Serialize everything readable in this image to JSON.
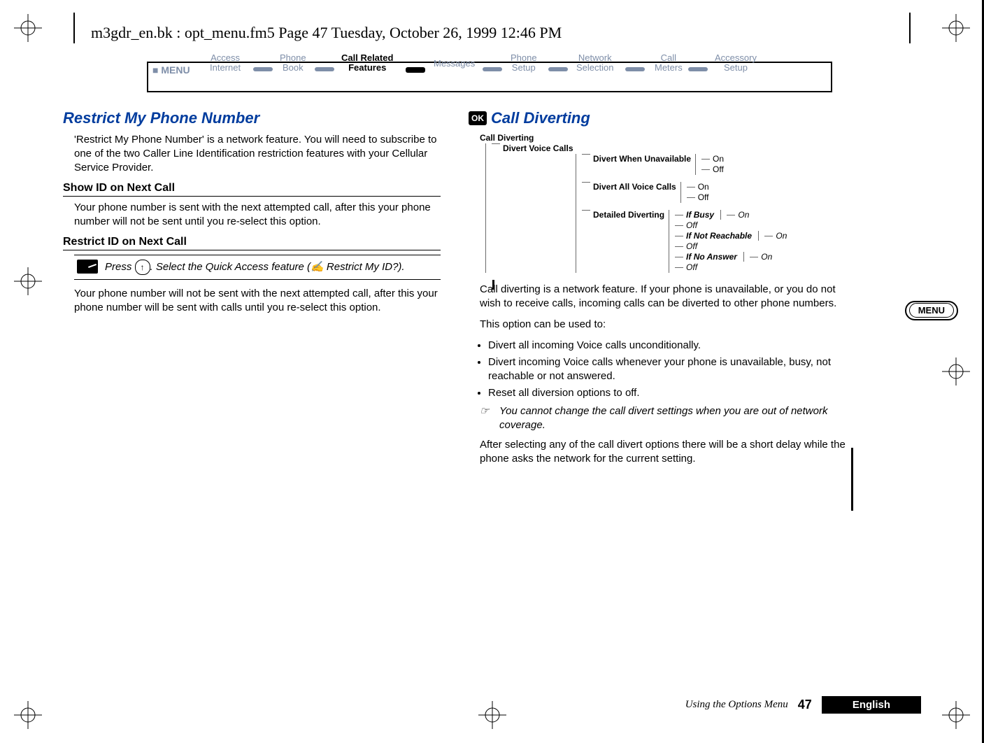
{
  "header_line": "m3gdr_en.bk : opt_menu.fm5  Page 47  Tuesday, October 26, 1999  12:46 PM",
  "menu": {
    "leading": "MENU",
    "items": [
      {
        "top": "Access",
        "bottom": "Internet",
        "active": false
      },
      {
        "top": "Phone",
        "bottom": "Book",
        "active": false
      },
      {
        "top": "Call Related",
        "bottom": "Features",
        "active": true
      },
      {
        "top": "Messages",
        "bottom": "",
        "active": false
      },
      {
        "top": "Phone",
        "bottom": "Setup",
        "active": false
      },
      {
        "top": "Network",
        "bottom": "Selection",
        "active": false
      },
      {
        "top": "Call",
        "bottom": "Meters",
        "active": false
      },
      {
        "top": "Accessory",
        "bottom": "Setup",
        "active": false
      }
    ]
  },
  "left": {
    "title": "Restrict My Phone Number",
    "intro": "'Restrict My Phone Number' is a network feature. You will need to subscribe to one of the two Caller Line Identification restriction features with your Cellular Service Provider.",
    "sub1": "Show ID on Next Call",
    "sub1_body": "Your phone number is sent with the next attempted call, after this your phone number will not be sent until you re-select this option.",
    "sub2": "Restrict ID on Next Call",
    "quick_prefix": "Press ",
    "quick_key": "↑",
    "quick_middle": ". Select the Quick Access feature (",
    "quick_icon": "✍",
    "quick_suffix": " Restrict My ID?).",
    "sub2_body": "Your phone number will not be sent with the next attempted call, after this your phone number will be sent with calls until you re-select this option."
  },
  "right": {
    "ok_label": "OK",
    "title": "Call Diverting",
    "tree": {
      "root": "Call Diverting",
      "l1": "Divert Voice Calls",
      "n1": {
        "label": "Divert When Unavailable",
        "opts": [
          "On",
          "Off"
        ]
      },
      "n2": {
        "label": "Divert All Voice Calls",
        "opts": [
          "On",
          "Off"
        ]
      },
      "n3": {
        "label": "Detailed Diverting",
        "children": [
          {
            "label": "If Busy",
            "opts": [
              "On",
              "Off"
            ]
          },
          {
            "label": "If Not Reachable",
            "opts": [
              "On",
              "Off"
            ]
          },
          {
            "label": "If No Answer",
            "opts": [
              "On",
              "Off"
            ]
          }
        ]
      }
    },
    "body1": "Call diverting is a network feature. If your phone is unavailable, or you do not wish to receive calls, incoming calls can be diverted to other phone numbers.",
    "body2": "This option can be used to:",
    "bullets": [
      "Divert all incoming Voice calls unconditionally.",
      "Divert incoming Voice calls whenever your phone is unavailable, busy, not reachable or not answered.",
      "Reset all diversion options to off."
    ],
    "note_icon": "☞",
    "note": "You cannot change the call divert settings when you are out of network coverage.",
    "body3": "After selecting any of the call divert options there will be a short delay while the phone asks the network for the current setting."
  },
  "side_btn": "MENU",
  "footer": {
    "using": "Using the Options Menu",
    "page": "47",
    "lang": "English"
  }
}
